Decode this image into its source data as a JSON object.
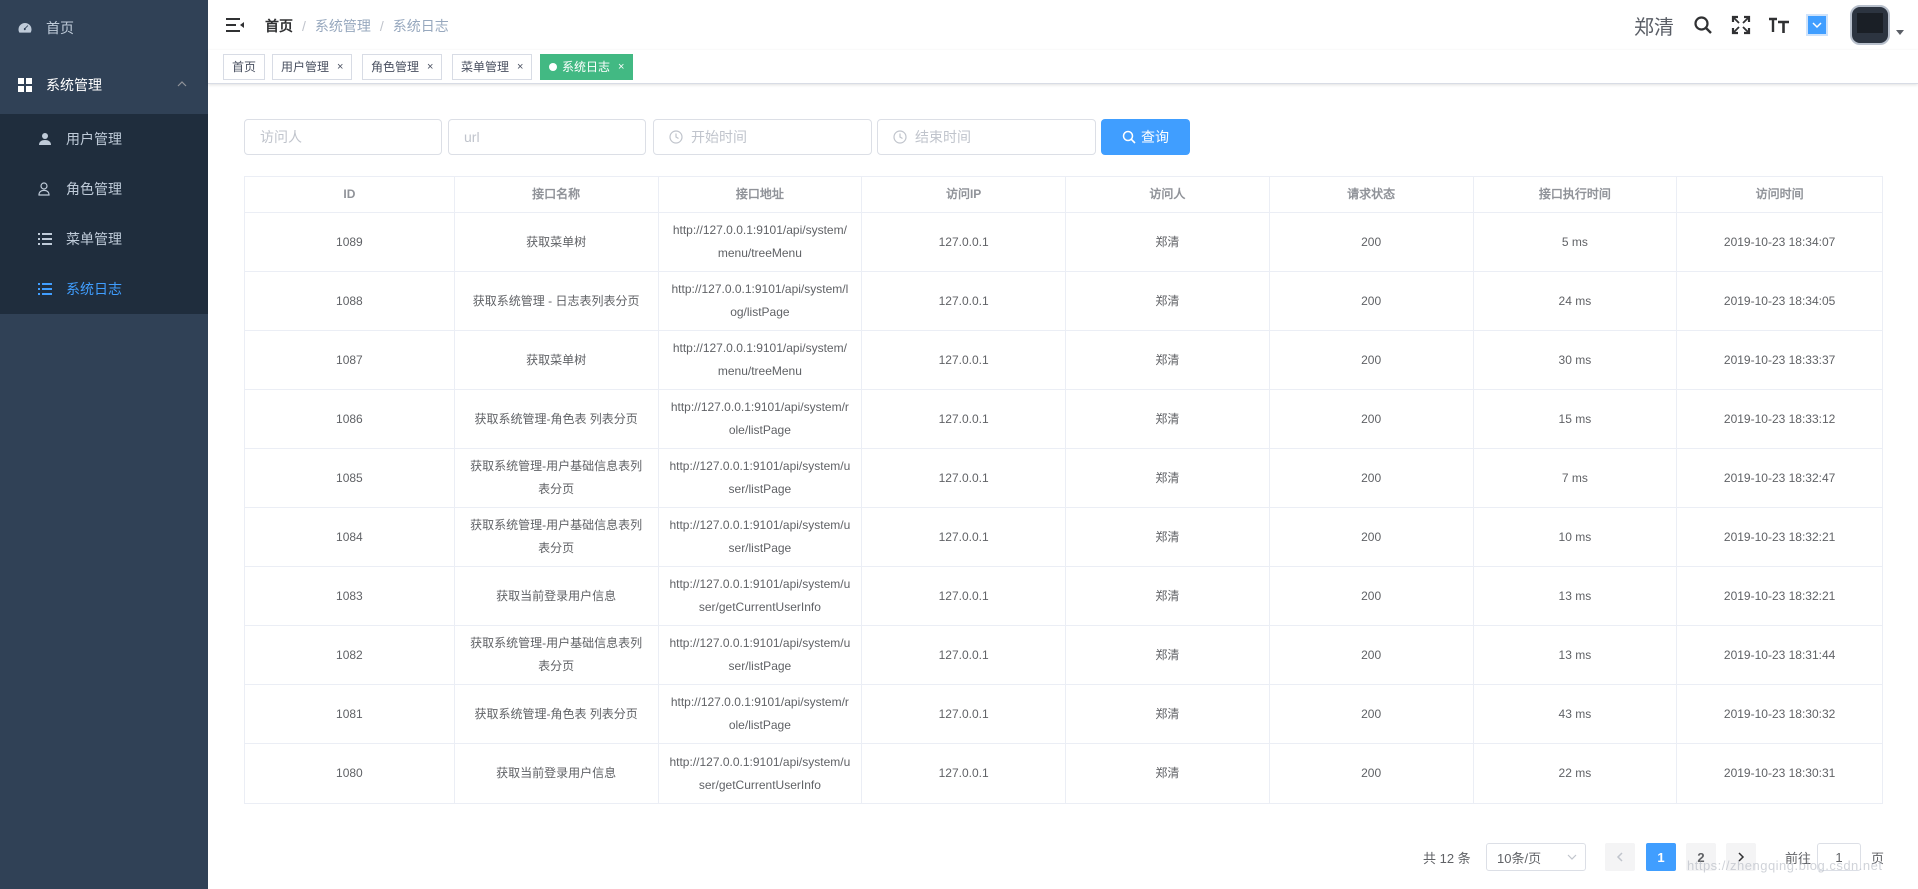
{
  "sidebar": {
    "home_label": "首页",
    "group_label": "系统管理",
    "items": [
      {
        "label": "用户管理"
      },
      {
        "label": "角色管理"
      },
      {
        "label": "菜单管理"
      },
      {
        "label": "系统日志"
      }
    ],
    "active_color": "#409eff",
    "bg_color": "#304156"
  },
  "navbar": {
    "breadcrumb": [
      "首页",
      "系统管理",
      "系统日志"
    ],
    "breadcrumb_sep": "/",
    "user_name": "郑清"
  },
  "tags": [
    {
      "label": "首页"
    },
    {
      "label": "用户管理",
      "close": "×"
    },
    {
      "label": "角色管理",
      "close": "×"
    },
    {
      "label": "菜单管理",
      "close": "×"
    },
    {
      "label": "系统日志",
      "close": "×"
    }
  ],
  "filters": {
    "visitor_placeholder": "访问人",
    "url_placeholder": "url",
    "start_placeholder": "开始时间",
    "end_placeholder": "结束时间",
    "query_label": "查询"
  },
  "table": {
    "headers": [
      "ID",
      "接口名称",
      "接口地址",
      "访问IP",
      "访问人",
      "请求状态",
      "接口执行时间",
      "访问时间"
    ],
    "rows": [
      {
        "id": "1089",
        "name": "获取菜单树",
        "url": "http://127.0.0.1:9101/api/system/menu/treeMenu",
        "ip": "127.0.0.1",
        "user": "郑清",
        "status": "200",
        "time": "5 ms",
        "at": "2019-10-23 18:34:07"
      },
      {
        "id": "1088",
        "name": "获取系统管理 - 日志表列表分页",
        "url": "http://127.0.0.1:9101/api/system/log/listPage",
        "ip": "127.0.0.1",
        "user": "郑清",
        "status": "200",
        "time": "24 ms",
        "at": "2019-10-23 18:34:05"
      },
      {
        "id": "1087",
        "name": "获取菜单树",
        "url": "http://127.0.0.1:9101/api/system/menu/treeMenu",
        "ip": "127.0.0.1",
        "user": "郑清",
        "status": "200",
        "time": "30 ms",
        "at": "2019-10-23 18:33:37"
      },
      {
        "id": "1086",
        "name": "获取系统管理-角色表 列表分页",
        "url": "http://127.0.0.1:9101/api/system/role/listPage",
        "ip": "127.0.0.1",
        "user": "郑清",
        "status": "200",
        "time": "15 ms",
        "at": "2019-10-23 18:33:12"
      },
      {
        "id": "1085",
        "name": "获取系统管理-用户基础信息表列表分页",
        "url": "http://127.0.0.1:9101/api/system/user/listPage",
        "ip": "127.0.0.1",
        "user": "郑清",
        "status": "200",
        "time": "7 ms",
        "at": "2019-10-23 18:32:47"
      },
      {
        "id": "1084",
        "name": "获取系统管理-用户基础信息表列表分页",
        "url": "http://127.0.0.1:9101/api/system/user/listPage",
        "ip": "127.0.0.1",
        "user": "郑清",
        "status": "200",
        "time": "10 ms",
        "at": "2019-10-23 18:32:21"
      },
      {
        "id": "1083",
        "name": "获取当前登录用户信息",
        "url": "http://127.0.0.1:9101/api/system/user/getCurrentUserInfo",
        "ip": "127.0.0.1",
        "user": "郑清",
        "status": "200",
        "time": "13 ms",
        "at": "2019-10-23 18:32:21"
      },
      {
        "id": "1082",
        "name": "获取系统管理-用户基础信息表列表分页",
        "url": "http://127.0.0.1:9101/api/system/user/listPage",
        "ip": "127.0.0.1",
        "user": "郑清",
        "status": "200",
        "time": "13 ms",
        "at": "2019-10-23 18:31:44"
      },
      {
        "id": "1081",
        "name": "获取系统管理-角色表 列表分页",
        "url": "http://127.0.0.1:9101/api/system/role/listPage",
        "ip": "127.0.0.1",
        "user": "郑清",
        "status": "200",
        "time": "43 ms",
        "at": "2019-10-23 18:30:32"
      },
      {
        "id": "1080",
        "name": "获取当前登录用户信息",
        "url": "http://127.0.0.1:9101/api/system/user/getCurrentUserInfo",
        "ip": "127.0.0.1",
        "user": "郑清",
        "status": "200",
        "time": "22 ms",
        "at": "2019-10-23 18:30:31"
      }
    ]
  },
  "pagination": {
    "total": "共 12 条",
    "page_size": "10条/页",
    "pages": [
      "1",
      "2"
    ],
    "current": "1",
    "goto_label": "前往",
    "goto_value": "1",
    "goto_unit": "页"
  },
  "watermark": "https://zhengqing.blog.csdn.net"
}
